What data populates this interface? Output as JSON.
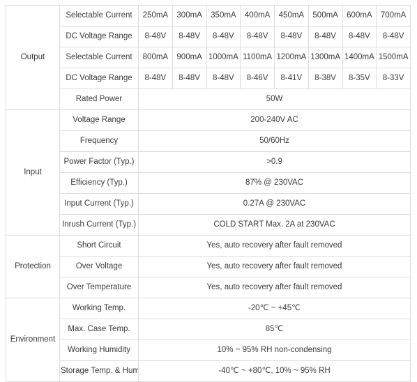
{
  "table": {
    "sections": [
      {
        "category": "Output",
        "rows": [
          {
            "param": "Selectable Current",
            "type": "multi",
            "values": [
              "250mA",
              "300mA",
              "350mA",
              "400mA",
              "450mA",
              "500mA",
              "600mA",
              "700mA"
            ]
          },
          {
            "param": "DC Voltage Range",
            "type": "multi",
            "values": [
              "8-48V",
              "8-48V",
              "8-48V",
              "8-48V",
              "8-48V",
              "8-48V",
              "8-48V",
              "8-48V"
            ]
          },
          {
            "param": "Selectable Current",
            "type": "multi",
            "values": [
              "800mA",
              "900mA",
              "1000mA",
              "1100mA",
              "1200mA",
              "1300mA",
              "1400mA",
              "1500mA"
            ]
          },
          {
            "param": "DC Voltage Range",
            "type": "multi",
            "values": [
              "8-48V",
              "8-48V",
              "8-48V",
              "8-46V",
              "8-41V",
              "8-38V",
              "8-35V",
              "8-33V"
            ]
          },
          {
            "param": "Rated Power",
            "type": "single",
            "value": "50W"
          }
        ]
      },
      {
        "category": "Input",
        "rows": [
          {
            "param": "Voltage Range",
            "type": "single",
            "value": "200-240V AC"
          },
          {
            "param": "Frequency",
            "type": "single",
            "value": "50/60Hz"
          },
          {
            "param": "Power Factor (Typ.)",
            "type": "single",
            "value": ">0.9"
          },
          {
            "param": "Efficiency (Typ.)",
            "type": "single",
            "value": "87% @ 230VAC"
          },
          {
            "param": "Input Current (Typ.)",
            "type": "single",
            "value": "0.27A @ 230VAC"
          },
          {
            "param": "Inrush Current (Typ.)",
            "type": "single",
            "value": "COLD START Max. 2A at 230VAC"
          }
        ]
      },
      {
        "category": "Protection",
        "rows": [
          {
            "param": "Short Circuit",
            "type": "single",
            "value": "Yes, auto recovery after fault removed"
          },
          {
            "param": "Over Voltage",
            "type": "single",
            "value": "Yes, auto recovery after fault removed"
          },
          {
            "param": "Over Temperature",
            "type": "single",
            "value": "Yes, auto recovery after fault removed"
          }
        ]
      },
      {
        "category": "Environment",
        "rows": [
          {
            "param": "Working Temp.",
            "type": "single",
            "value": "-20℃ ~ +45℃"
          },
          {
            "param": "Max. Case Temp.",
            "type": "single",
            "value": "85℃"
          },
          {
            "param": "Working Humidity",
            "type": "single",
            "value": "10% ~ 95% RH non-condensing"
          },
          {
            "param": "Storage Temp. & Humidity",
            "type": "single",
            "value": "-40℃ ~ +80℃, 10% ~ 95% RH",
            "two_line": true
          }
        ]
      }
    ]
  }
}
